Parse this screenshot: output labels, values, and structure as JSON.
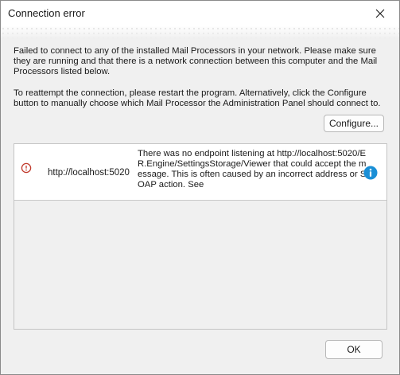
{
  "window": {
    "title": "Connection error"
  },
  "messages": {
    "line1": "Failed to connect to any of the installed Mail Processors in your network. Please make sure they are running and that there is a network connection between this computer and the Mail Processors listed below.",
    "line2": "To reattempt the connection, please restart the program. Alternatively, click the Configure button to manually choose which Mail Processor the Administration Panel should connect to."
  },
  "buttons": {
    "configure": "Configure...",
    "ok": "OK"
  },
  "processors": [
    {
      "url": "http://localhost:5020",
      "message": "There was no endpoint listening at http://localhost:5020/ER.Engine/SettingsStorage/Viewer that could accept the message. This is often caused by an incorrect address or SOAP action. See",
      "status_icon": "error-circle-icon",
      "info_icon": "info-icon"
    }
  ],
  "colors": {
    "error": "#c0392b",
    "info": "#1a8fd6",
    "dialog_bg": "#f0f0f0"
  }
}
